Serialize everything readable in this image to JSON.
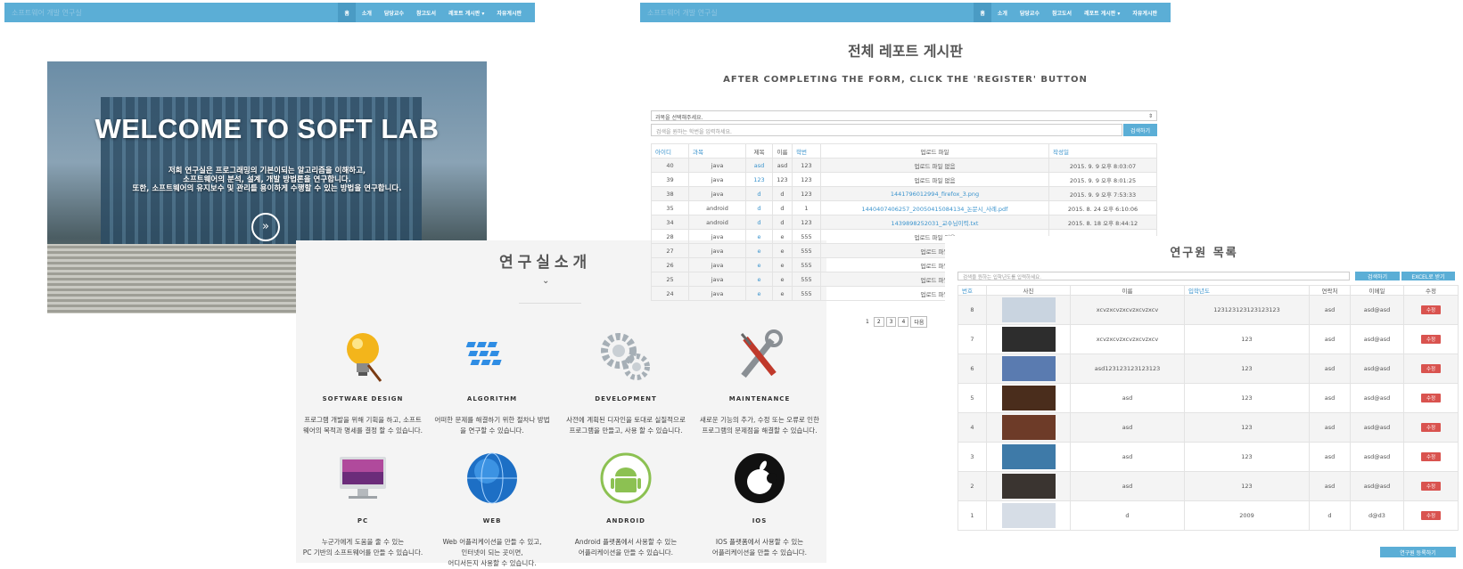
{
  "nav": {
    "brand": "소프트웨어 개발 연구실",
    "items": [
      {
        "label": "홈"
      },
      {
        "label": "소개"
      },
      {
        "label": "담당교수"
      },
      {
        "label": "참고도서"
      },
      {
        "label": "레포트 게시판 ▾"
      },
      {
        "label": "자유게시판"
      }
    ]
  },
  "hero": {
    "title": "WELCOME TO SOFT LAB",
    "lines": [
      "저희 연구실은 프로그래밍의 기본이되는 알고리즘을 이해하고,",
      "소프트웨어의 분석, 설계, 개발 방법론을 연구합니다.",
      "또한, 소프트웨어의 유지보수 및 관리를 용이하게 수행할 수 있는 방법을 연구합니다."
    ]
  },
  "intro": {
    "title": "연구실소개",
    "features": [
      {
        "title": "SOFTWARE DESIGN",
        "desc1": "프로그램 개발을 위해 기획을 하고, 소프트",
        "desc2": "웨어의 목적과 명세를 결정 할 수 있습니다.",
        "icon": "lightbulb-icon"
      },
      {
        "title": "ALGORITHM",
        "desc1": "어떠한 문제를 해결하기 위한 절차나 방법",
        "desc2": "을 연구할 수 있습니다.",
        "icon": "keyboard-icon"
      },
      {
        "title": "DEVELOPMENT",
        "desc1": "사전에 계획된 디자인을 토대로 실질적으로",
        "desc2": "프로그램을 만들고, 사용 할 수 있습니다.",
        "icon": "gears-icon"
      },
      {
        "title": "MAINTENANCE",
        "desc1": "새로운 기능의 추가, 수정 또는 오류로 인한",
        "desc2": "프로그램의 문제점을 해결할 수 있습니다.",
        "icon": "tools-icon"
      },
      {
        "title": "PC",
        "desc1": "누군가에게 도움을 줄 수 있는",
        "desc2": "PC 기반의 소프트웨어를 만들 수 있습니다.",
        "icon": "imac-icon"
      },
      {
        "title": "WEB",
        "desc1": "Web 어플리케이션을 만들 수 있고,",
        "desc2": "인터넷이 되는 곳이면,",
        "desc3": "어디서든지 사용할 수 있습니다.",
        "icon": "globe-icon"
      },
      {
        "title": "ANDROID",
        "desc1": "Android 플랫폼에서 사용할 수 있는",
        "desc2": "어플리케이션을 만들 수 있습니다.",
        "icon": "android-icon"
      },
      {
        "title": "IOS",
        "desc1": "IOS 플랫폼에서 사용할 수 있는",
        "desc2": "어플리케이션을 만들 수 있습니다.",
        "icon": "apple-icon"
      }
    ]
  },
  "board": {
    "title": "전체 레포트 게시판",
    "subtitle": "AFTER COMPLETING THE FORM, CLICK THE 'REGISTER' BUTTON",
    "select_value": "과목을 선택해주세요.",
    "search_placeholder": "검색을 원하는 학번을 입력하세요.",
    "search_button": "검색하기",
    "columns": [
      "아이디",
      "과목",
      "제목",
      "이름",
      "학번",
      "업로드 파일",
      "작성일"
    ],
    "rows": [
      {
        "id": "40",
        "subject": "java",
        "title": "asd",
        "name": "asd",
        "num": "123",
        "file": "업로드 파일 없음",
        "date": "2015. 9. 9 오후 8:03:07"
      },
      {
        "id": "39",
        "subject": "java",
        "title": "123",
        "name": "123",
        "num": "123",
        "file": "업로드 파일 없음",
        "date": "2015. 9. 9 오후 8:01:25"
      },
      {
        "id": "38",
        "subject": "java",
        "title": "d",
        "name": "d",
        "num": "123",
        "file": "1441796012994_firefox_3.png",
        "date": "2015. 9. 9 오후 7:53:33"
      },
      {
        "id": "35",
        "subject": "android",
        "title": "d",
        "name": "d",
        "num": "1",
        "file": "1440407406257_20050415084134_논문시_사례.pdf",
        "date": "2015. 8. 24 오후 6:10:06"
      },
      {
        "id": "34",
        "subject": "android",
        "title": "d",
        "name": "d",
        "num": "123",
        "file": "1439898252031_교수님이력.txt",
        "date": "2015. 8. 18 오후 8:44:12"
      },
      {
        "id": "28",
        "subject": "java",
        "title": "e",
        "name": "e",
        "num": "555",
        "file": "업로드 파일 없음",
        "date": ""
      },
      {
        "id": "27",
        "subject": "java",
        "title": "e",
        "name": "e",
        "num": "555",
        "file": "업로드 파일",
        "date": ""
      },
      {
        "id": "26",
        "subject": "java",
        "title": "e",
        "name": "e",
        "num": "555",
        "file": "업로드 파일",
        "date": ""
      },
      {
        "id": "25",
        "subject": "java",
        "title": "e",
        "name": "e",
        "num": "555",
        "file": "업로드 파일",
        "date": ""
      },
      {
        "id": "24",
        "subject": "java",
        "title": "e",
        "name": "e",
        "num": "555",
        "file": "업로드 파일",
        "date": ""
      }
    ],
    "pages": [
      "1",
      "2",
      "3",
      "4",
      "다음"
    ]
  },
  "members": {
    "title": "연구원 목록",
    "search_placeholder": "검색을 원하는 입학년도를 입력하세요.",
    "search_button": "검색하기",
    "excel_button": "EXCEL로 받기",
    "columns": [
      "번호",
      "사진",
      "이름",
      "입학년도",
      "연락처",
      "이메일",
      "수정"
    ],
    "rows": [
      {
        "no": "8",
        "name": "xcvzxcvzxcvzxcvzxcv",
        "year": "123123123123123123",
        "phone": "asd",
        "email": "asd@asd",
        "edit": "수정"
      },
      {
        "no": "7",
        "name": "xcvzxcvzxcvzxcvzxcv",
        "year": "123",
        "phone": "asd",
        "email": "asd@asd",
        "edit": "수정"
      },
      {
        "no": "6",
        "name": "asd123123123123123",
        "year": "123",
        "phone": "asd",
        "email": "asd@asd",
        "edit": "수정"
      },
      {
        "no": "5",
        "name": "asd",
        "year": "123",
        "phone": "asd",
        "email": "asd@asd",
        "edit": "수정"
      },
      {
        "no": "4",
        "name": "asd",
        "year": "123",
        "phone": "asd",
        "email": "asd@asd",
        "edit": "수정"
      },
      {
        "no": "3",
        "name": "asd",
        "year": "123",
        "phone": "asd",
        "email": "asd@asd",
        "edit": "수정"
      },
      {
        "no": "2",
        "name": "asd",
        "year": "123",
        "phone": "asd",
        "email": "asd@asd",
        "edit": "수정"
      },
      {
        "no": "1",
        "name": "d",
        "year": "2009",
        "phone": "d",
        "email": "d@d3",
        "edit": "수정"
      }
    ],
    "register_button": "연구원 등록하기"
  }
}
